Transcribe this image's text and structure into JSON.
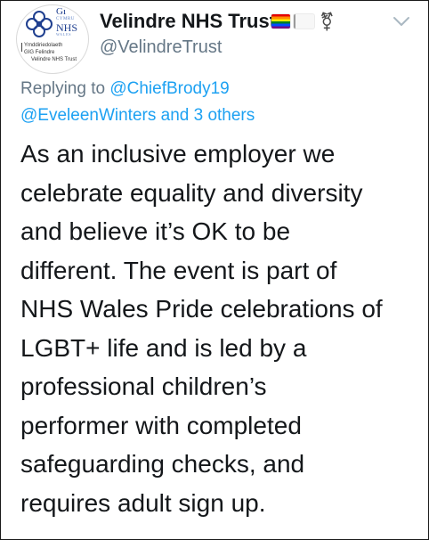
{
  "author": {
    "display_name": "Velindre NHS Trust",
    "handle": "@VelindreTrust",
    "name_emoji": [
      "rainbow-flag-icon",
      "white-flag-icon",
      "transgender-symbol-icon"
    ],
    "trans_symbol_glyph": "⚧"
  },
  "avatar": {
    "logo_top": {
      "gi": "Gı",
      "cymru": "CYMRU",
      "nhs": "NHS",
      "wales": "WALES"
    },
    "logo_lines": [
      "Ymddiriedolaeth",
      "GIG Felindre",
      "Velindre NHS Trust"
    ]
  },
  "reply": {
    "prefix": "Replying to ",
    "to_user": "@ChiefBrody19",
    "user2": "@EveleenWinters",
    "conjunction": " and ",
    "others": "3 others"
  },
  "tweet": {
    "lines": [
      "As an inclusive employer we",
      "celebrate equality and diversity",
      "and believe it’s OK to be",
      "different. The event is part of",
      "NHS Wales Pride celebrations of",
      "LGBT+ life and is led by a",
      "professional children’s",
      "performer with completed",
      "safeguarding checks, and",
      "requires adult sign up."
    ]
  },
  "colors": {
    "link": "#1da1f2",
    "muted": "#657786",
    "text": "#14171a",
    "nhs_blue": "#1f3f8f"
  },
  "menu": {
    "icon": "chevron-down-icon"
  }
}
